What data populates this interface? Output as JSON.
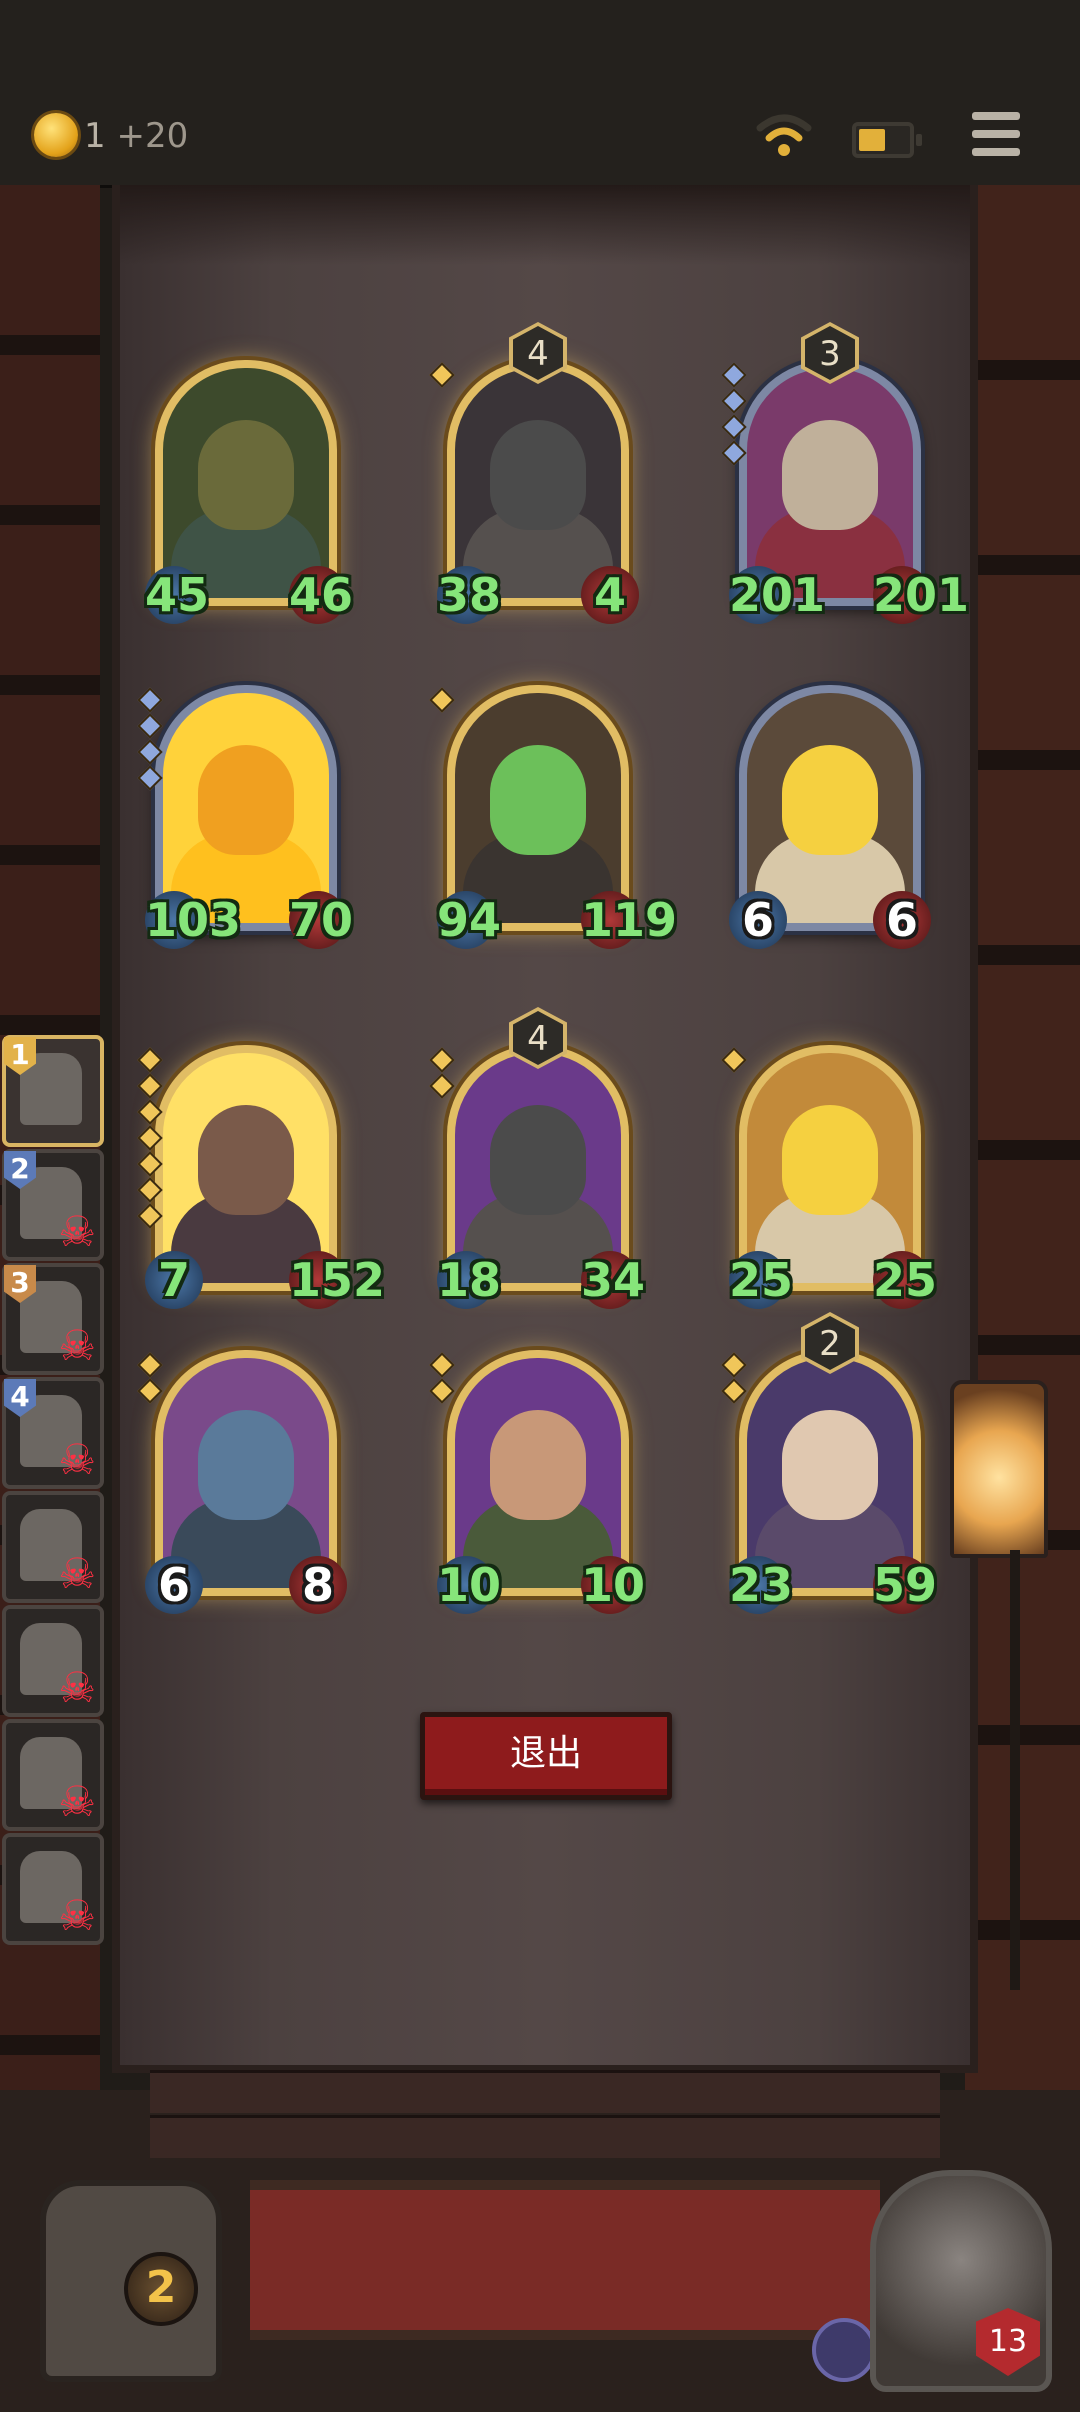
{
  "top_bar": {
    "gold_value": "1",
    "gold_income": "+20"
  },
  "board": {
    "cards": [
      {
        "id": "c1",
        "attack": "45",
        "health": "46",
        "tier": "",
        "frame": "gold",
        "pips": 0,
        "pip_color": "gold",
        "colors": {
          "bg": "#3d4a2c",
          "head": "#6a6a3a",
          "body": "#3f5346"
        }
      },
      {
        "id": "c2",
        "attack": "38",
        "health": "4",
        "tier": "4",
        "frame": "gold",
        "pips": 1,
        "pip_color": "gold",
        "colors": {
          "bg": "#3a3438",
          "head": "#4b4b4b",
          "body": "#55504e"
        }
      },
      {
        "id": "c3",
        "attack": "201",
        "health": "201",
        "tier": "3",
        "frame": "silver",
        "pips": 4,
        "pip_color": "blue",
        "colors": {
          "bg": "#7a3a6a",
          "head": "#c0b09a",
          "body": "#8a3040"
        }
      },
      {
        "id": "c4",
        "attack": "103",
        "health": "70",
        "tier": "",
        "frame": "silver",
        "pips": 4,
        "pip_color": "blue",
        "colors": {
          "bg": "#ffd23a",
          "head": "#f0a020",
          "body": "#ffc01e"
        }
      },
      {
        "id": "c5",
        "attack": "94",
        "health": "119",
        "tier": "",
        "frame": "gold",
        "pips": 1,
        "pip_color": "gold",
        "colors": {
          "bg": "#4b3d2e",
          "head": "#6cc05a",
          "body": "#3a3430"
        }
      },
      {
        "id": "c6",
        "attack": "6",
        "health": "6",
        "tier": "",
        "frame": "silver",
        "pips": 0,
        "pip_color": "gold",
        "colors": {
          "bg": "#5b4a3a",
          "head": "#f5d040",
          "body": "#d8c8a8"
        },
        "white": true
      },
      {
        "id": "c7",
        "attack": "7",
        "health": "152",
        "tier": "",
        "frame": "gold",
        "pips": 7,
        "pip_color": "gold",
        "colors": {
          "bg": "#ffe066",
          "head": "#7a5a4a",
          "body": "#4a3a40"
        }
      },
      {
        "id": "c8",
        "attack": "18",
        "health": "34",
        "tier": "4",
        "frame": "gold",
        "pips": 2,
        "pip_color": "gold",
        "colors": {
          "bg": "#6a3a8a",
          "head": "#4b4b4b",
          "body": "#55504e"
        }
      },
      {
        "id": "c9",
        "attack": "25",
        "health": "25",
        "tier": "",
        "frame": "gold",
        "pips": 1,
        "pip_color": "gold",
        "colors": {
          "bg": "#c28a3a",
          "head": "#f5d040",
          "body": "#d8c8a8"
        }
      },
      {
        "id": "c10",
        "attack": "6",
        "health": "8",
        "tier": "",
        "frame": "gold",
        "pips": 2,
        "pip_color": "gold",
        "colors": {
          "bg": "#7a4a8a",
          "head": "#5a7a9a",
          "body": "#3a4a5a"
        },
        "white": true
      },
      {
        "id": "c11",
        "attack": "10",
        "health": "10",
        "tier": "",
        "frame": "gold",
        "pips": 2,
        "pip_color": "gold",
        "colors": {
          "bg": "#6a3a8a",
          "head": "#c89878",
          "body": "#4a5a3a"
        }
      },
      {
        "id": "c12",
        "attack": "23",
        "health": "59",
        "tier": "2",
        "frame": "gold",
        "pips": 2,
        "pip_color": "gold",
        "colors": {
          "bg": "#4a3a6a",
          "head": "#e0c8b0",
          "body": "#5a4a6a"
        }
      }
    ]
  },
  "sidebar": {
    "players": [
      {
        "rank": "1",
        "active": true,
        "eliminated": false,
        "rank_color": "#e2b24a"
      },
      {
        "rank": "2",
        "active": false,
        "eliminated": true,
        "rank_color": "#5c7ab8"
      },
      {
        "rank": "3",
        "active": false,
        "eliminated": true,
        "rank_color": "#c88a4a"
      },
      {
        "rank": "4",
        "active": false,
        "eliminated": true,
        "rank_color": "#5c7ab8"
      },
      {
        "rank": "",
        "active": false,
        "eliminated": true,
        "rank_color": ""
      },
      {
        "rank": "",
        "active": false,
        "eliminated": true,
        "rank_color": ""
      },
      {
        "rank": "",
        "active": false,
        "eliminated": true,
        "rank_color": ""
      },
      {
        "rank": "",
        "active": false,
        "eliminated": true,
        "rank_color": ""
      }
    ]
  },
  "exit_button": {
    "label": "退出"
  },
  "bottom": {
    "chest_count": "2",
    "hero_health": "13"
  },
  "icons": {
    "skull": "skull-crossbones-icon",
    "coin": "crown-coin-icon",
    "wifi": "wifi-icon",
    "battery": "battery-icon",
    "menu": "menu-icon"
  }
}
